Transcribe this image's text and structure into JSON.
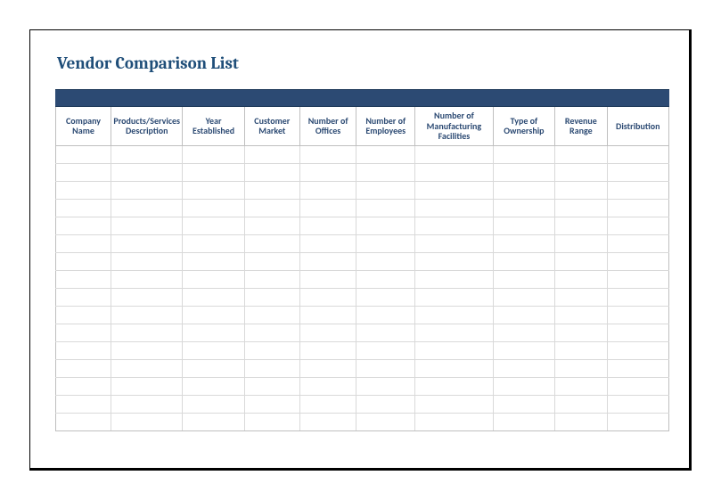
{
  "title": "Vendor Comparison List",
  "columns": [
    "Company Name",
    "Products/Services Description",
    "Year Established",
    "Customer Market",
    "Number of Offices",
    "Number of Employees",
    "Number of Manufacturing Facilities",
    "Type of Ownership",
    "Revenue Range",
    "Distribution"
  ],
  "rows": [
    [
      "",
      "",
      "",
      "",
      "",
      "",
      "",
      "",
      "",
      ""
    ],
    [
      "",
      "",
      "",
      "",
      "",
      "",
      "",
      "",
      "",
      ""
    ],
    [
      "",
      "",
      "",
      "",
      "",
      "",
      "",
      "",
      "",
      ""
    ],
    [
      "",
      "",
      "",
      "",
      "",
      "",
      "",
      "",
      "",
      ""
    ],
    [
      "",
      "",
      "",
      "",
      "",
      "",
      "",
      "",
      "",
      ""
    ],
    [
      "",
      "",
      "",
      "",
      "",
      "",
      "",
      "",
      "",
      ""
    ],
    [
      "",
      "",
      "",
      "",
      "",
      "",
      "",
      "",
      "",
      ""
    ],
    [
      "",
      "",
      "",
      "",
      "",
      "",
      "",
      "",
      "",
      ""
    ],
    [
      "",
      "",
      "",
      "",
      "",
      "",
      "",
      "",
      "",
      ""
    ],
    [
      "",
      "",
      "",
      "",
      "",
      "",
      "",
      "",
      "",
      ""
    ],
    [
      "",
      "",
      "",
      "",
      "",
      "",
      "",
      "",
      "",
      ""
    ],
    [
      "",
      "",
      "",
      "",
      "",
      "",
      "",
      "",
      "",
      ""
    ],
    [
      "",
      "",
      "",
      "",
      "",
      "",
      "",
      "",
      "",
      ""
    ],
    [
      "",
      "",
      "",
      "",
      "",
      "",
      "",
      "",
      "",
      ""
    ],
    [
      "",
      "",
      "",
      "",
      "",
      "",
      "",
      "",
      "",
      ""
    ],
    [
      "",
      "",
      "",
      "",
      "",
      "",
      "",
      "",
      "",
      ""
    ]
  ]
}
